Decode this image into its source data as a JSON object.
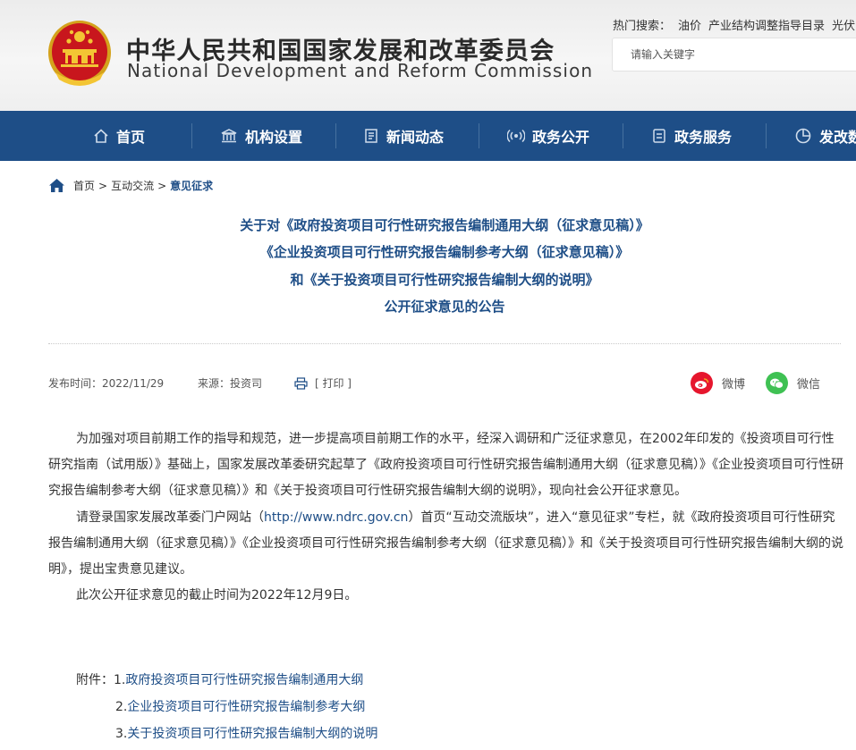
{
  "header": {
    "site_name_cn": "中华人民共和国国家发展和改革委员会",
    "site_name_en": "National Development and Reform Commission",
    "hot_label": "热门搜索：",
    "hot_keywords": [
      "油价",
      "产业结构调整指导目录",
      "光伏"
    ],
    "search_placeholder": "请输入关键字"
  },
  "nav": {
    "items": [
      {
        "label": "首页",
        "icon": "home-icon"
      },
      {
        "label": "机构设置",
        "icon": "institution-icon"
      },
      {
        "label": "新闻动态",
        "icon": "news-icon"
      },
      {
        "label": "政务公开",
        "icon": "broadcast-icon"
      },
      {
        "label": "政务服务",
        "icon": "service-icon"
      },
      {
        "label": "发改数",
        "icon": "pie-chart-icon"
      }
    ]
  },
  "breadcrumb": {
    "home": "首页",
    "section": "互动交流",
    "current": "意见征求",
    "separator": ">"
  },
  "article": {
    "title_lines": [
      "关于对《政府投资项目可行性研究报告编制通用大纲（征求意见稿）》",
      "《企业投资项目可行性研究报告编制参考大纲（征求意见稿）》",
      "和《关于投资项目可行性研究报告编制大纲的说明》",
      "公开征求意见的公告"
    ],
    "publish_label": "发布时间：",
    "publish_date": "2022/11/29",
    "source_label": "来源：",
    "source": "投资司",
    "print_label": "[ 打印 ]",
    "share_weibo": "微博",
    "share_wechat": "微信",
    "paragraph1": "为加强对项目前期工作的指导和规范，进一步提高项目前期工作的水平，经深入调研和广泛征求意见，在2002年印发的《投资项目可行性研究指南（试用版）》基础上，国家发展改革委研究起草了《政府投资项目可行性研究报告编制通用大纲（征求意见稿）》《企业投资项目可行性研究报告编制参考大纲（征求意见稿）》和《关于投资项目可行性研究报告编制大纲的说明》，现向社会公开征求意见。",
    "paragraph2_before": "请登录国家发展改革委门户网站（",
    "paragraph2_link": "http://www.ndrc.gov.cn",
    "paragraph2_after": "）首页“互动交流版块”，进入“意见征求”专栏，就《政府投资项目可行性研究报告编制通用大纲（征求意见稿）》《企业投资项目可行性研究报告编制参考大纲（征求意见稿）》和《关于投资项目可行性研究报告编制大纲的说明》，提出宝贵意见建议。",
    "paragraph3": "此次公开征求意见的截止时间为2022年12月9日。",
    "attachments_label": "附件：",
    "attachments": [
      {
        "index": "1.",
        "label": "政府投资项目可行性研究报告编制通用大纲"
      },
      {
        "index": "2.",
        "label": "企业投资项目可行性研究报告编制参考大纲"
      },
      {
        "index": "3.",
        "label": "关于投资项目可行性研究报告编制大纲的说明"
      }
    ]
  },
  "colors": {
    "nav_bg": "#1e4e87",
    "title": "#1e4e87",
    "weibo": "#e6162d",
    "wechat": "#3fc153"
  }
}
